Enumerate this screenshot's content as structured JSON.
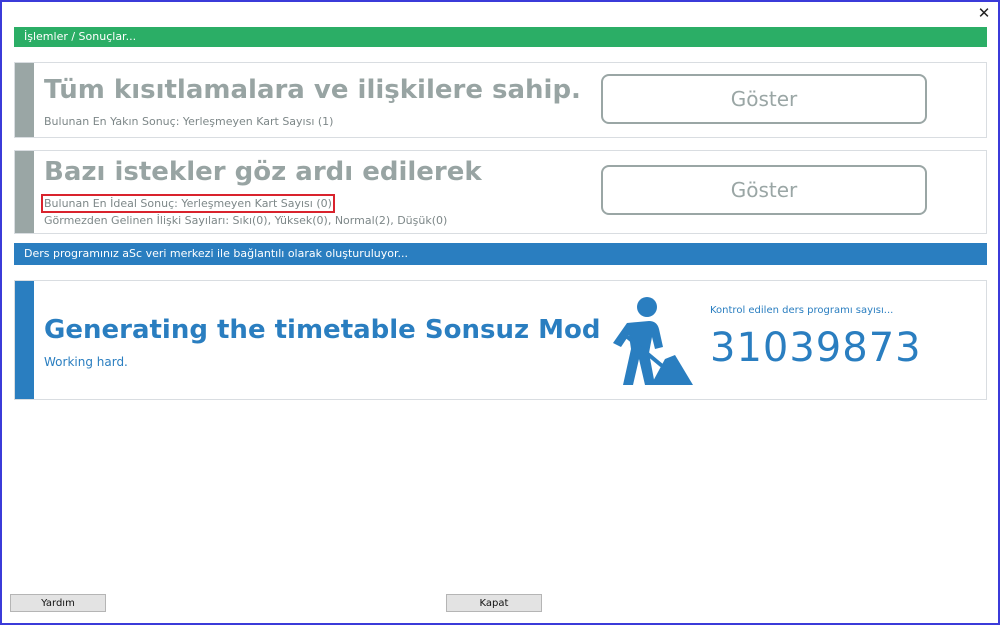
{
  "window": {
    "close_glyph": "✕"
  },
  "section_results": {
    "header": "İşlemler / Sonuçlar..."
  },
  "panel1": {
    "title": "Tüm kısıtlamalara ve ilişkilere sahip.",
    "subtitle": "Bulunan En Yakın Sonuç: Yerleşmeyen Kart Sayısı (1)",
    "button_label": "Göster"
  },
  "panel2": {
    "title": "Bazı istekler göz ardı edilerek",
    "subtitle": "Bulunan En İdeal Sonuç: Yerleşmeyen Kart Sayısı (0)",
    "details": "Görmezden Gelinen İlişki Sayıları: Sıkı(0), Yüksek(0), Normal(2), Düşük(0)",
    "button_label": "Göster"
  },
  "section_status": {
    "header": "Ders programınız aSc veri merkezi ile bağlantılı olarak oluşturuluyor..."
  },
  "panel3": {
    "title": "Generating the timetable Sonsuz Mod",
    "subtitle": "Working hard.",
    "icon": "worker-shovel-icon",
    "counter_label": "Kontrol edilen ders programı sayısı...",
    "counter_value": "31039873"
  },
  "footer": {
    "help_label": "Yardım",
    "close_label": "Kapat"
  },
  "colors": {
    "green": "#2bae66",
    "blue": "#2a7ec0",
    "gray": "#9aa6a5",
    "highlight": "#d9232d"
  }
}
